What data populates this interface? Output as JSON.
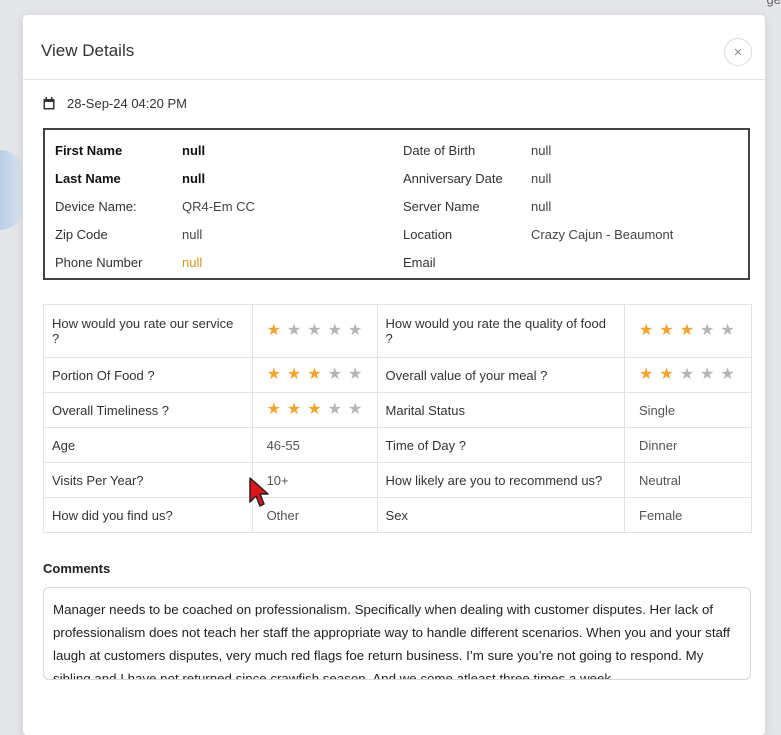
{
  "corner_text": "ge",
  "modal": {
    "title": "View Details",
    "close_symbol": "×",
    "date_time": "28-Sep-24 04:20 PM"
  },
  "customer_info": {
    "left": [
      {
        "label": "First Name",
        "value": "null"
      },
      {
        "label": "Last Name",
        "value": "null"
      },
      {
        "label": "Device Name:",
        "value": "QR4-Em CC"
      },
      {
        "label": "Zip Code",
        "value": "null"
      },
      {
        "label": "Phone Number",
        "value": "null"
      }
    ],
    "right": [
      {
        "label": "Date of Birth",
        "value": "null"
      },
      {
        "label": "Anniversary Date",
        "value": "null"
      },
      {
        "label": "Server Name",
        "value": "null"
      },
      {
        "label": "Location",
        "value": "Crazy Cajun - Beaumont"
      },
      {
        "label": "Email",
        "value": ""
      }
    ]
  },
  "ratings": [
    {
      "q1": "How would you rate our service ?",
      "stars1": 1,
      "q2": "How would you rate the quality of food ?",
      "stars2": 3
    },
    {
      "q1": "Portion Of Food ?",
      "stars1": 3,
      "q2": "Overall value of your meal ?",
      "stars2": 2
    },
    {
      "q1": "Overall Timeliness ?",
      "stars1": 3,
      "q2": "Marital Status",
      "a2": "Single"
    },
    {
      "q1": "Age",
      "a1": "46-55",
      "q2": "Time of Day ?",
      "a2": "Dinner"
    },
    {
      "q1": "Visits Per Year?",
      "a1": "10+",
      "q2": "How likely are you to recommend us?",
      "a2": "Neutral"
    },
    {
      "q1": "How did you find us?",
      "a1": "Other",
      "q2": "Sex",
      "a2": "Female"
    }
  ],
  "star_max": 5,
  "star_glyph": "★",
  "colors": {
    "star_on": "#f0a530",
    "star_off": "#b5b5b5",
    "phone_value": "#d6921e"
  },
  "comments": {
    "label": "Comments",
    "text": "Manager needs to be coached on professionalism. Specifically when dealing with customer disputes. Her lack of professionalism does not teach her staff the appropriate way to handle different scenarios. When you and your staff laugh at customers disputes, very much red flags foe return business. I’m sure you’re not going to respond. My sibling and I have not returned since crawfish season. And we come atleast three times a week. ."
  }
}
